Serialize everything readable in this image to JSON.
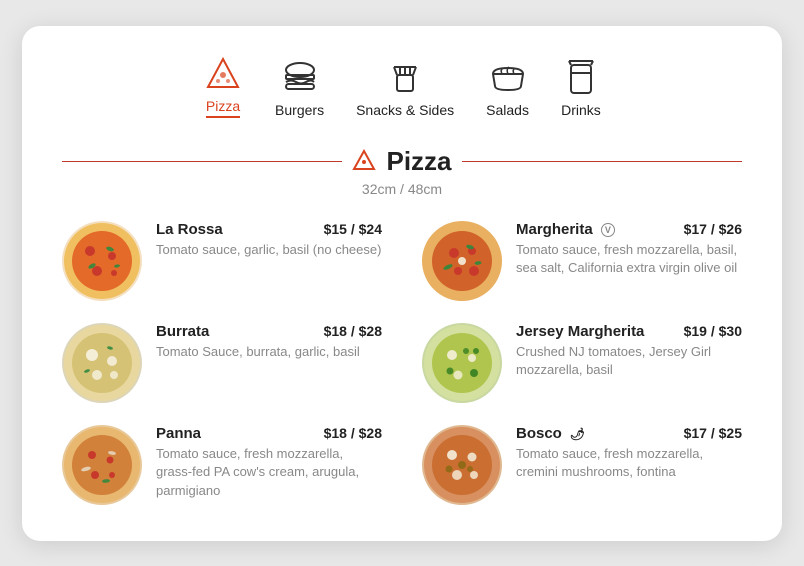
{
  "nav": {
    "items": [
      {
        "id": "pizza",
        "label": "Pizza",
        "active": true
      },
      {
        "id": "burgers",
        "label": "Burgers",
        "active": false
      },
      {
        "id": "snacks",
        "label": "Snacks & Sides",
        "active": false
      },
      {
        "id": "salads",
        "label": "Salads",
        "active": false
      },
      {
        "id": "drinks",
        "label": "Drinks",
        "active": false
      }
    ]
  },
  "section": {
    "title": "Pizza",
    "subtitle": "32cm / 48cm"
  },
  "menu": [
    {
      "col": "left",
      "items": [
        {
          "name": "La Rossa",
          "price": "$15 / $24",
          "desc": "Tomato sauce, garlic, basil (no cheese)",
          "badge": null,
          "chili": false
        },
        {
          "name": "Burrata",
          "price": "$18 / $28",
          "desc": "Tomato Sauce, burrata, garlic, basil",
          "badge": null,
          "chili": false
        },
        {
          "name": "Panna",
          "price": "$18 / $28",
          "desc": "Tomato sauce, fresh mozzarella, grass-fed PA cow's cream, arugula, parmigiano",
          "badge": null,
          "chili": false
        }
      ]
    },
    {
      "col": "right",
      "items": [
        {
          "name": "Margherita",
          "price": "$17 / $26",
          "desc": "Tomato sauce, fresh mozzarella, basil, sea salt, California extra virgin olive oil",
          "badge": "V",
          "chili": false
        },
        {
          "name": "Jersey Margherita",
          "price": "$19 / $30",
          "desc": "Crushed NJ tomatoes, Jersey Girl mozzarella, basil",
          "badge": null,
          "chili": false
        },
        {
          "name": "Bosco",
          "price": "$17 / $25",
          "desc": "Tomato sauce, fresh mozzarella, cremini mushrooms, fontina",
          "badge": null,
          "chili": true
        }
      ]
    }
  ],
  "colors": {
    "accent": "#d9431e"
  }
}
